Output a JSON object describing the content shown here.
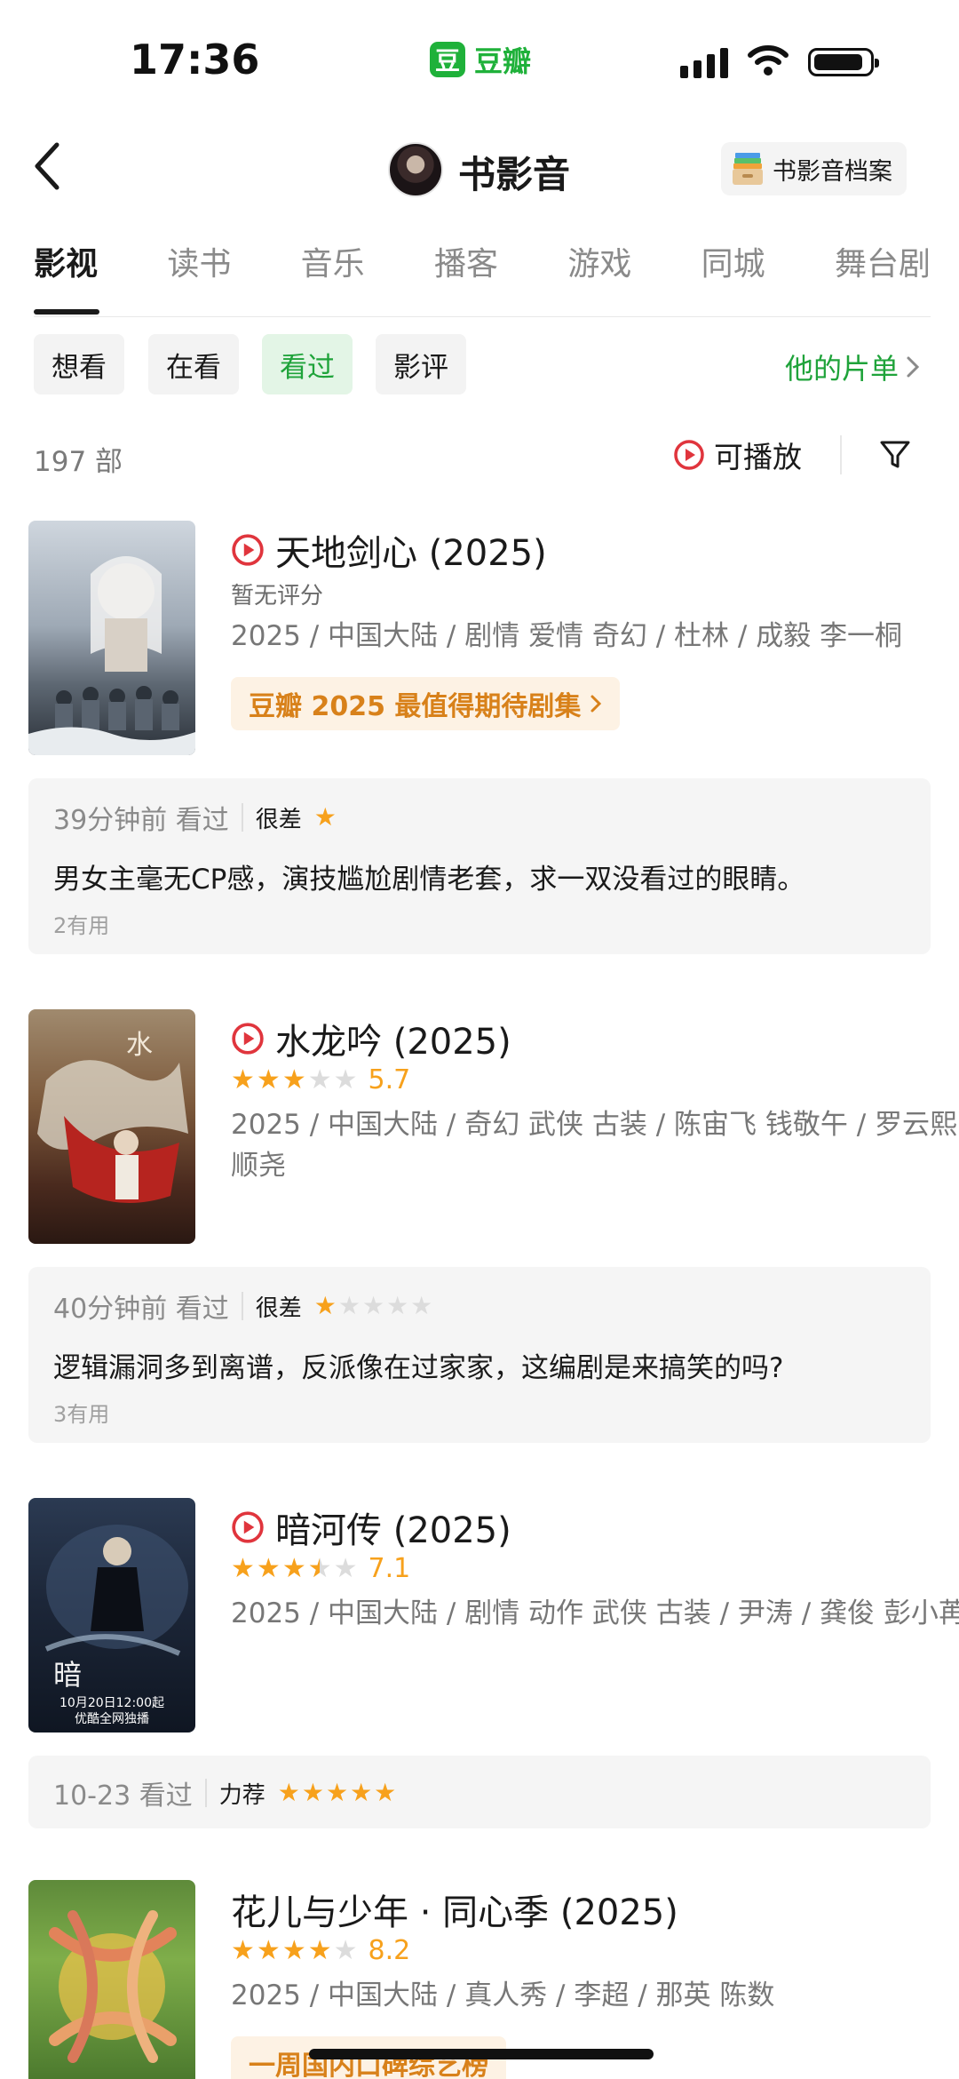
{
  "status": {
    "time": "17:36",
    "app_logo": "豆",
    "app_name": "豆瓣"
  },
  "header": {
    "title": "书影音",
    "archive_label": "书影音档案"
  },
  "tabs": [
    "影视",
    "读书",
    "音乐",
    "播客",
    "游戏",
    "同城",
    "舞台剧"
  ],
  "filters": [
    "想看",
    "在看",
    "看过",
    "影评"
  ],
  "list_link": "他的片单",
  "count_text": "197 部",
  "playable_label": "可播放",
  "items": [
    {
      "title": "天地剑心 (2025)",
      "rating_text": "暂无评分",
      "meta": "2025 / 中国大陆 / 剧情 爱情 奇幻 / 杜林 / 成毅 李一桐",
      "tag": "豆瓣 2025 最值得期待剧集",
      "review": {
        "time": "39分钟前 看过",
        "level": "很差",
        "stars": 1,
        "text": "男女主毫无CP感，演技尴尬剧情老套，求一双没看过的眼睛。",
        "useful": "2有用"
      }
    },
    {
      "title": "水龙吟 (2025)",
      "stars": 3,
      "score": "5.7",
      "meta": "2025 / 中国大陆 / 奇幻 武侠 古装 / 陈宙飞 钱敬午 / 罗云熙 肖顺尧",
      "review": {
        "time": "40分钟前 看过",
        "level": "很差",
        "stars": 1,
        "text": "逻辑漏洞多到离谱，反派像在过家家，这编剧是来搞笑的吗?",
        "useful": "3有用"
      }
    },
    {
      "title": "暗河传 (2025)",
      "stars": 3.5,
      "score": "7.1",
      "meta": "2025 / 中国大陆 / 剧情 动作 武侠 古装 / 尹涛 / 龚俊 彭小苒",
      "poster_caption_1": "10月20日12:00起",
      "poster_caption_2": "优酷全网独播",
      "review": {
        "time": "10-23 看过",
        "level": "力荐",
        "stars": 5
      }
    },
    {
      "title": "花儿与少年 · 同心季 (2025)",
      "stars": 4,
      "score": "8.2",
      "meta": "2025 / 中国大陆 / 真人秀 / 李超 / 那英 陈数",
      "tag": "一周国内口碑综艺榜"
    }
  ],
  "colors": {
    "accent_green": "#1fa33a",
    "star": "#f7a11c",
    "tag_text": "#d8811a",
    "play_red": "#e0353d"
  },
  "icons": [
    "back-icon",
    "wifi-icon",
    "archive-box-icon",
    "play-circle-icon",
    "filter-funnel-icon",
    "chevron-right-icon"
  ]
}
